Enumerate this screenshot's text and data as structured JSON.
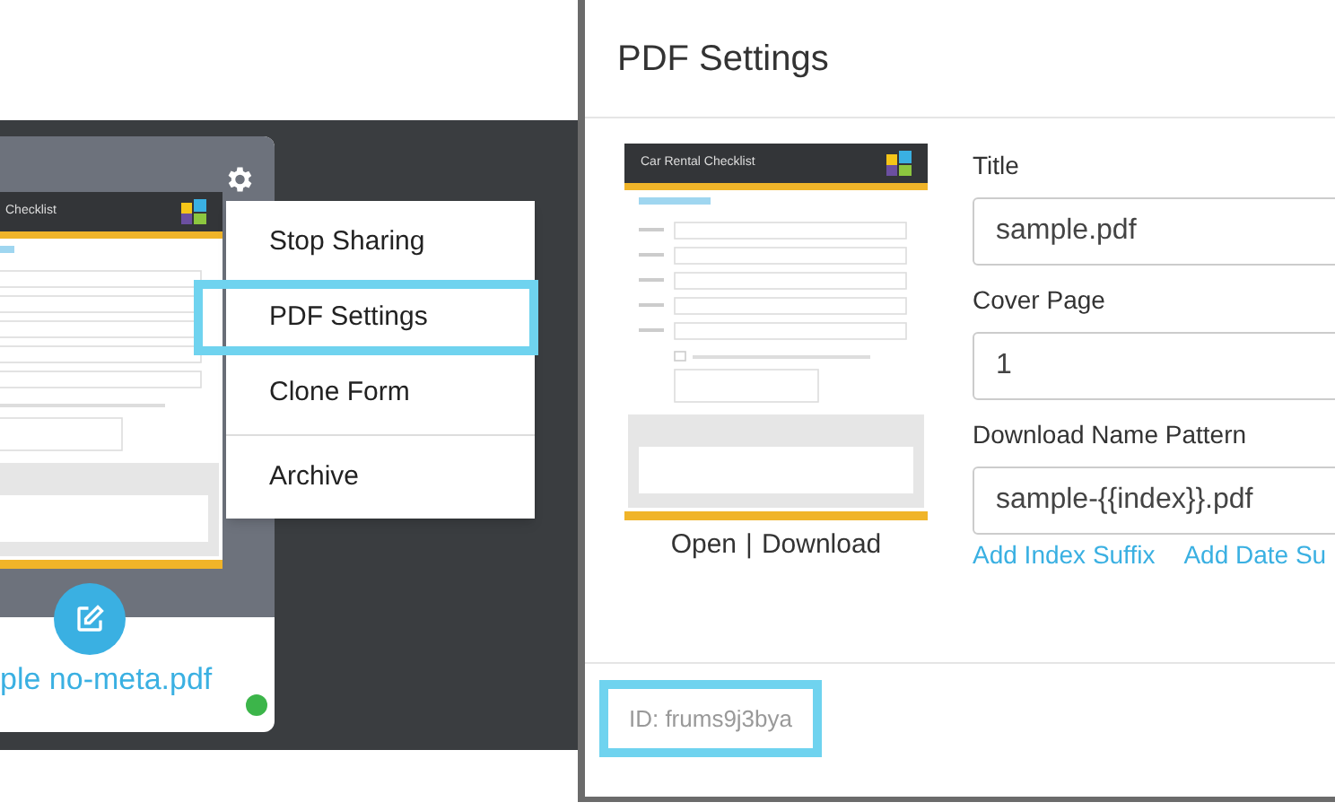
{
  "card": {
    "preview": {
      "title": "Checklist"
    },
    "filename": "ple no-meta.pdf",
    "status": {
      "color": "#3cb54a"
    }
  },
  "menu": {
    "sections": [
      [
        {
          "label": "Stop Sharing",
          "highlighted": false
        },
        {
          "label": "PDF Settings",
          "highlighted": true
        },
        {
          "label": "Clone Form",
          "highlighted": false
        }
      ],
      [
        {
          "label": "Archive",
          "highlighted": false
        }
      ]
    ]
  },
  "dialog": {
    "title": "PDF Settings",
    "preview": {
      "title": "Car Rental Checklist"
    },
    "preview_links": {
      "open": "Open",
      "separator": "|",
      "download": "Download"
    },
    "fields": [
      {
        "label": "Title",
        "value": "sample.pdf"
      },
      {
        "label": "Cover Page",
        "value": "1"
      },
      {
        "label": "Download Name Pattern",
        "value": "sample-{{index}}.pdf"
      }
    ],
    "suffix_links": [
      "Add Index Suffix",
      "Add Date Su"
    ],
    "id_text": "ID: frums9j3bya",
    "id_highlighted": true
  }
}
